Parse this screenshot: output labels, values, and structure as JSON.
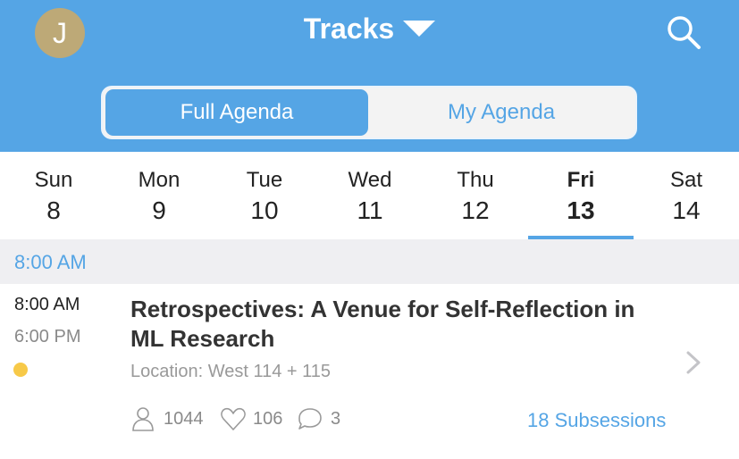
{
  "header": {
    "avatar_initial": "J",
    "title": "Tracks",
    "colors": {
      "header_bg": "#55a5e5",
      "avatar_bg": "#bda977"
    },
    "icons": {
      "caret": "caret-down-icon",
      "search": "search-icon"
    }
  },
  "segment": {
    "full_agenda": "Full Agenda",
    "my_agenda": "My Agenda",
    "selected": "Full Agenda"
  },
  "days": [
    {
      "dow": "Sun",
      "num": "8"
    },
    {
      "dow": "Mon",
      "num": "9"
    },
    {
      "dow": "Tue",
      "num": "10"
    },
    {
      "dow": "Wed",
      "num": "11"
    },
    {
      "dow": "Thu",
      "num": "12"
    },
    {
      "dow": "Fri",
      "num": "13",
      "selected": true
    },
    {
      "dow": "Sat",
      "num": "14"
    }
  ],
  "time_header": "8:00 AM",
  "session": {
    "start": "8:00 AM",
    "end": "6:00 PM",
    "title": "Retrospectives: A Venue for Self-Reflection in ML Research",
    "location": "Location: West 114 + 115",
    "dot_color": "#f7c948",
    "attendees": "1044",
    "likes": "106",
    "comments": "3",
    "subsessions": "18 Subsessions",
    "icons": {
      "attendees": "person-icon",
      "likes": "heart-icon",
      "comments": "comment-icon",
      "chevron": "chevron-right-icon"
    }
  }
}
